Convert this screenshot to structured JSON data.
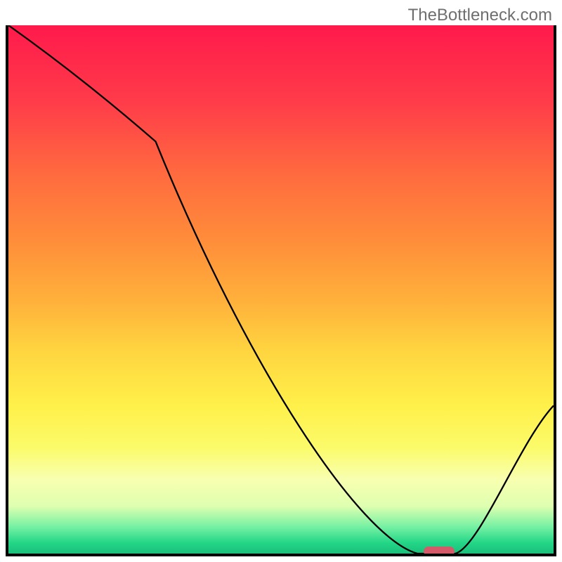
{
  "watermark": "TheBottleneck.com",
  "colors": {
    "border": "#000000",
    "marker": "#d45a6a",
    "gradient_top": "#ff1a4b",
    "gradient_bottom": "#1bbf7a"
  },
  "chart_data": {
    "type": "line",
    "title": "",
    "xlabel": "",
    "ylabel": "",
    "xlim": [
      0,
      100
    ],
    "ylim": [
      0,
      100
    ],
    "x": [
      0,
      27,
      75,
      82,
      100
    ],
    "values": [
      100,
      78,
      0,
      0,
      28
    ],
    "marker_x": 79,
    "marker_y": 0,
    "notes": "Valley curve on rainbow gradient; minimum (bottleneck sweet spot) around x=75–82. No axis ticks, no legend, no numeric labels visible."
  }
}
